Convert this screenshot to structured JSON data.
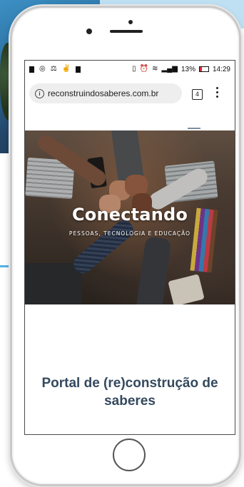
{
  "status_bar": {
    "battery_percent": "13%",
    "time": "14:29"
  },
  "browser": {
    "url": "reconstruindosaberes.com.br",
    "tab_count": "4"
  },
  "hero": {
    "title": "Conectando",
    "subtitle": "PESSOAS, TECNOLOGIA E EDUCAÇÃO"
  },
  "main": {
    "portal_title": "Portal de (re)construção de saberes"
  },
  "icons": {
    "info": "info-icon",
    "tabs": "tabs-icon",
    "menu": "more-vert-icon",
    "hamburger": "hamburger-menu-icon"
  },
  "colors": {
    "title_text": "#34495e",
    "battery_low": "#e0263a",
    "url_pill": "#eeeeee"
  }
}
